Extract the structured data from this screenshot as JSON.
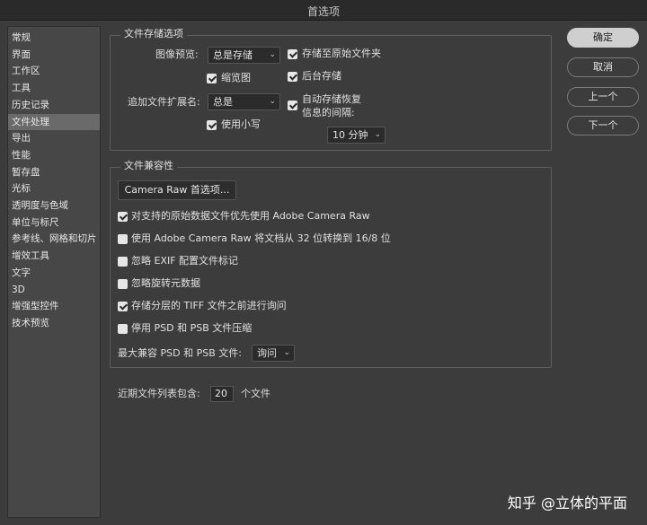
{
  "window": {
    "title": "首选项"
  },
  "sidebar": {
    "items": [
      {
        "label": "常规"
      },
      {
        "label": "界面"
      },
      {
        "label": "工作区"
      },
      {
        "label": "工具"
      },
      {
        "label": "历史记录"
      },
      {
        "label": "文件处理",
        "selected": true
      },
      {
        "label": "导出"
      },
      {
        "label": "性能"
      },
      {
        "label": "暂存盘"
      },
      {
        "label": "光标"
      },
      {
        "label": "透明度与色域"
      },
      {
        "label": "单位与标尺"
      },
      {
        "label": "参考线、网格和切片"
      },
      {
        "label": "增效工具"
      },
      {
        "label": "文字"
      },
      {
        "label": "3D"
      },
      {
        "label": "增强型控件"
      },
      {
        "label": "技术预览"
      }
    ]
  },
  "file_save": {
    "title": "文件存储选项",
    "image_preview_label": "图像预览:",
    "image_preview_value": "总是存储",
    "thumbnail_label": "缩览图",
    "thumbnail_checked": true,
    "extension_label": "追加文件扩展名:",
    "extension_value": "总是",
    "lowercase_label": "使用小写",
    "lowercase_checked": true,
    "save_original_folder_label": "存储至原始文件夹",
    "save_original_folder_checked": true,
    "background_save_label": "后台存储",
    "background_save_checked": true,
    "auto_recover_label_1": "自动存储恢复",
    "auto_recover_label_2": "信息的间隔:",
    "auto_recover_checked": true,
    "interval_value": "10 分钟"
  },
  "compat": {
    "title": "文件兼容性",
    "camera_raw_button": "Camera Raw 首选项...",
    "options": [
      {
        "label": "对支持的原始数据文件优先使用 Adobe Camera Raw",
        "checked": true
      },
      {
        "label": "使用 Adobe Camera Raw 将文档从 32 位转换到 16/8 位",
        "checked": false
      },
      {
        "label": "忽略 EXIF 配置文件标记",
        "checked": false
      },
      {
        "label": "忽略旋转元数据",
        "checked": false
      },
      {
        "label": "存储分层的 TIFF 文件之前进行询问",
        "checked": true
      },
      {
        "label": "停用 PSD 和 PSB 文件压缩",
        "checked": false
      }
    ],
    "max_compat_label": "最大兼容 PSD 和 PSB 文件:",
    "max_compat_value": "询问"
  },
  "recent": {
    "label": "近期文件列表包含:",
    "value": "20",
    "suffix": "个文件"
  },
  "buttons": {
    "ok": "确定",
    "cancel": "取消",
    "prev": "上一个",
    "next": "下一个"
  },
  "watermark": "知乎 @立体的平面"
}
